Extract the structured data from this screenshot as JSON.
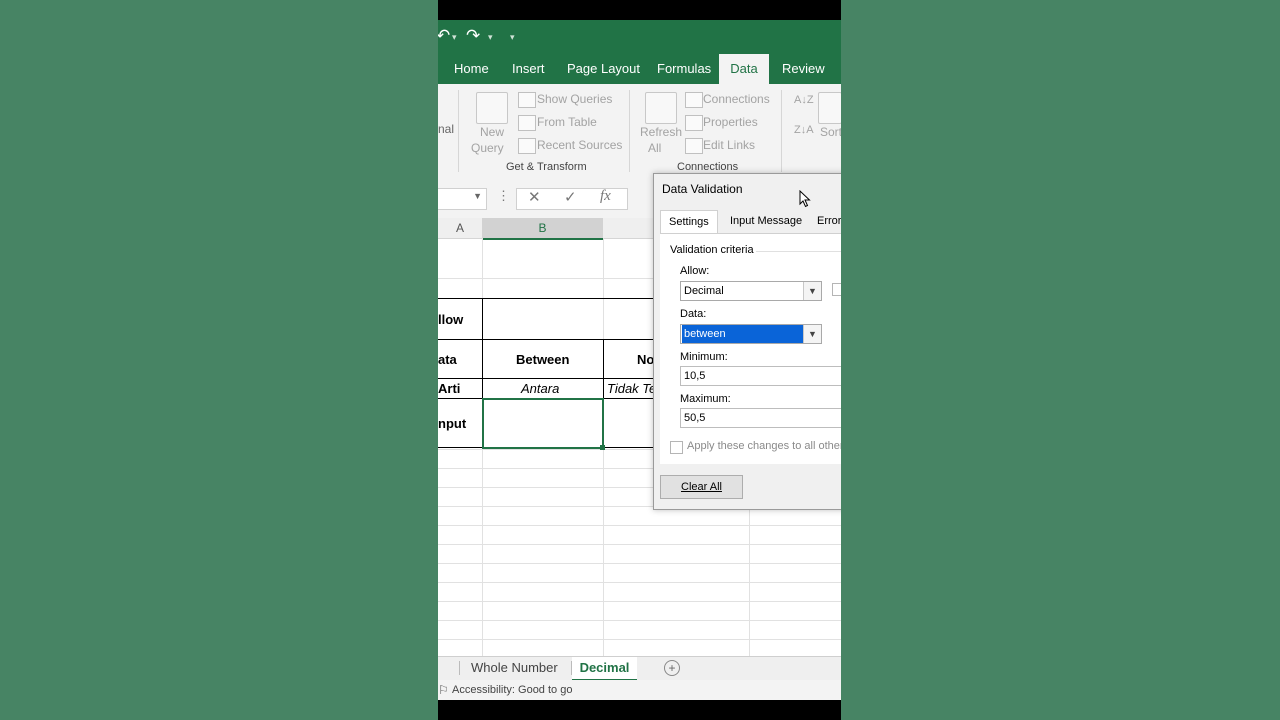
{
  "qat": {
    "redo_icon": "redo-arrow-icon",
    "customize_icon": "customize-qat-icon"
  },
  "ribbon_tabs": [
    "Home",
    "Insert",
    "Page Layout",
    "Formulas",
    "Data",
    "Review"
  ],
  "active_tab": "Data",
  "ribbon": {
    "get_external_fragment": "nal",
    "new_query_line1": "New",
    "new_query_line2": "Query",
    "show_queries": "Show Queries",
    "from_table": "From Table",
    "recent_sources": "Recent Sources",
    "group_get_transform": "Get & Transform",
    "refresh_line1": "Refresh",
    "refresh_line2": "All",
    "connections": "Connections",
    "properties": "Properties",
    "edit_links": "Edit Links",
    "group_connections": "Connections",
    "sort": "Sort"
  },
  "formula_bar": {
    "cancel": "✕",
    "enter": "✓",
    "fx": "fx",
    "more": "⋮"
  },
  "columns": [
    "A",
    "B"
  ],
  "sheet": {
    "row_allow": "llow",
    "row_data": "ata",
    "between": "Between",
    "not_fragment": "No",
    "row_arti": "Arti",
    "antara": "Antara",
    "tidak_fragment": "Tidak Te",
    "row_input": "nput"
  },
  "sheet_tabs": [
    "Whole Number",
    "Decimal"
  ],
  "active_sheet": "Decimal",
  "add_sheet": "+",
  "status": "Accessibility: Good to go",
  "dialog": {
    "title": "Data Validation",
    "tabs": [
      "Settings",
      "Input Message",
      "Error"
    ],
    "section": "Validation criteria",
    "allow_label": "Allow:",
    "allow_value": "Decimal",
    "data_label": "Data:",
    "data_value": "between",
    "minimum_label": "Minimum:",
    "minimum_value": "10,5",
    "maximum_label": "Maximum:",
    "maximum_value": "50,5",
    "apply_label": "Apply these changes to all other c",
    "clear_all": "Clear All"
  },
  "colors": {
    "excel_green": "#217346",
    "selection_blue": "#0a64d8",
    "background": "#478464"
  }
}
